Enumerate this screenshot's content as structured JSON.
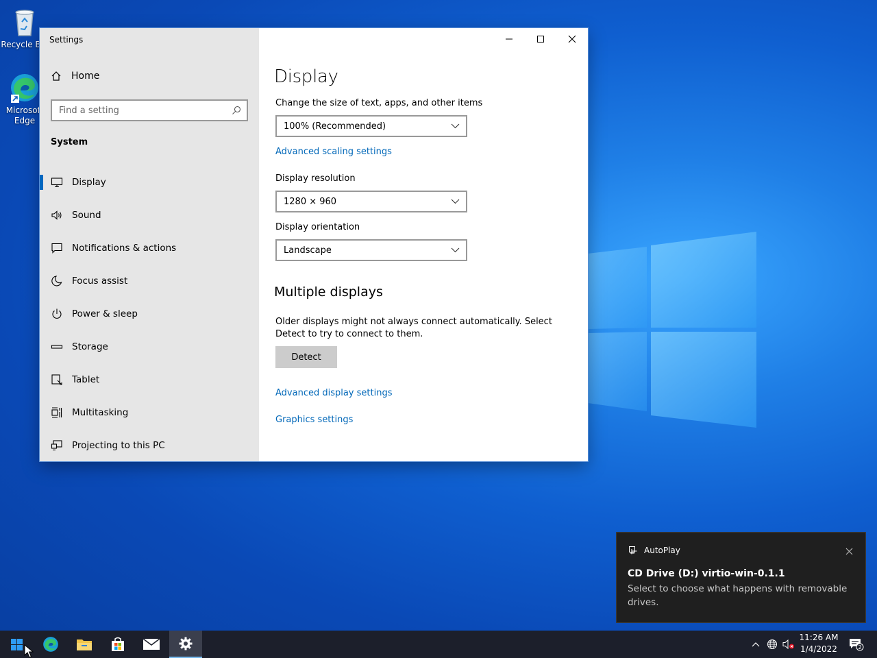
{
  "desktop": {
    "icons": [
      {
        "label": "Recycle Bin"
      },
      {
        "label": "Microsoft Edge"
      }
    ]
  },
  "window": {
    "title": "Settings",
    "sidebar": {
      "home_label": "Home",
      "search_placeholder": "Find a setting",
      "section_label": "System",
      "items": [
        {
          "label": "Display",
          "icon": "monitor-icon",
          "active": true
        },
        {
          "label": "Sound",
          "icon": "speaker-icon"
        },
        {
          "label": "Notifications & actions",
          "icon": "message-icon"
        },
        {
          "label": "Focus assist",
          "icon": "moon-icon"
        },
        {
          "label": "Power & sleep",
          "icon": "power-icon"
        },
        {
          "label": "Storage",
          "icon": "drive-icon"
        },
        {
          "label": "Tablet",
          "icon": "tablet-icon"
        },
        {
          "label": "Multitasking",
          "icon": "multitasking-icon"
        },
        {
          "label": "Projecting to this PC",
          "icon": "projector-icon"
        }
      ]
    },
    "content": {
      "title": "Display",
      "scale_label": "Change the size of text, apps, and other items",
      "scale_value": "100% (Recommended)",
      "advanced_scaling_link": "Advanced scaling settings",
      "resolution_label": "Display resolution",
      "resolution_value": "1280 × 960",
      "orientation_label": "Display orientation",
      "orientation_value": "Landscape",
      "multiple_displays_title": "Multiple displays",
      "multiple_displays_text": "Older displays might not always connect automatically. Select Detect to try to connect to them.",
      "detect_label": "Detect",
      "advanced_display_link": "Advanced display settings",
      "graphics_link": "Graphics settings"
    }
  },
  "toast": {
    "app": "AutoPlay",
    "title": "CD Drive (D:) virtio-win-0.1.1",
    "body": "Select to choose what happens with removable drives."
  },
  "taskbar": {
    "time": "11:26 AM",
    "date": "1/4/2022",
    "notification_count": "2"
  },
  "colors": {
    "accent": "#0067c0",
    "link": "#0067b8",
    "taskbar": "#1c1f2b",
    "sidebar": "#e6e6e6"
  }
}
